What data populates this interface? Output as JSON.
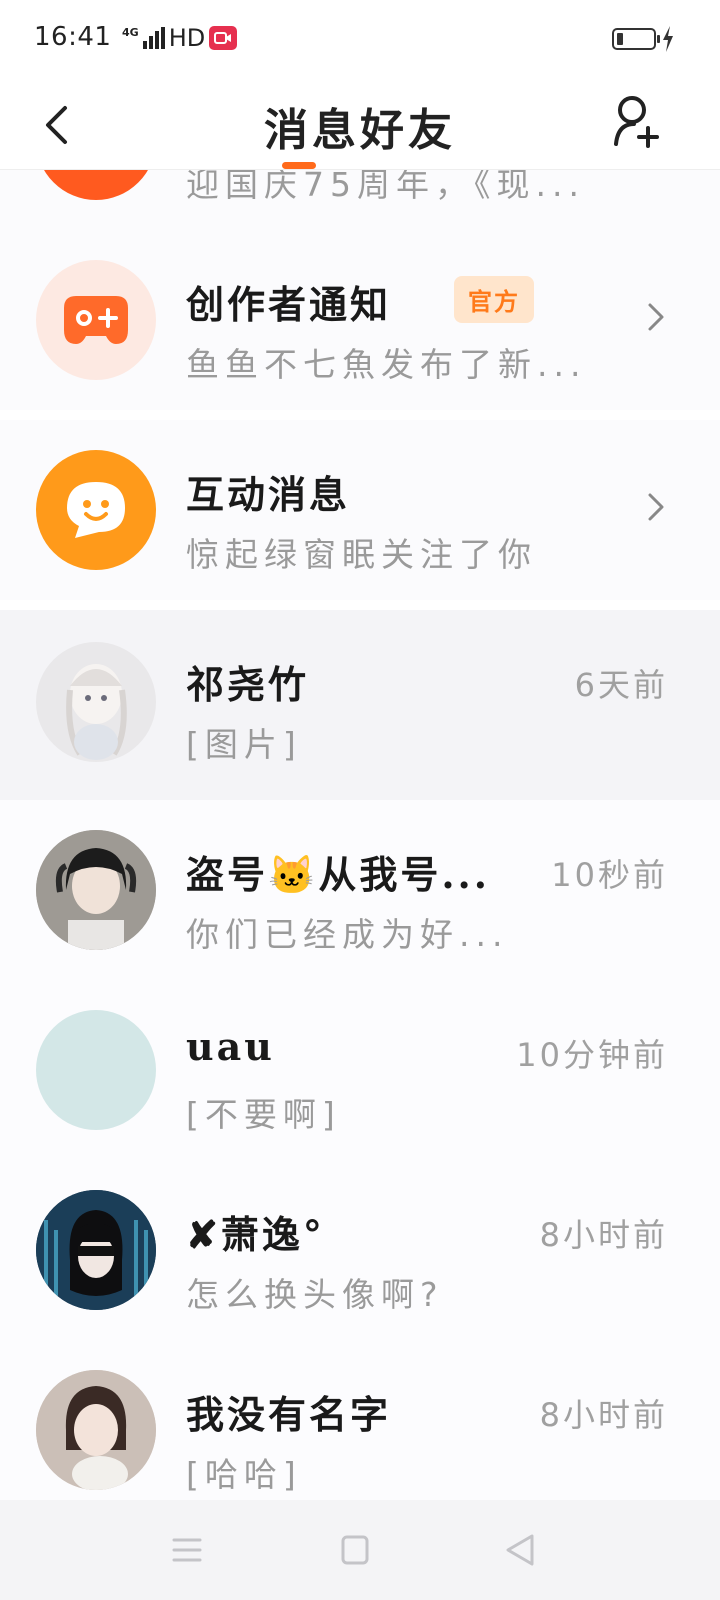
{
  "status_bar": {
    "time": "16:41",
    "network": "4G",
    "hd": "HD",
    "battery_percent": 15
  },
  "header": {
    "title": "消息好友"
  },
  "conversations": [
    {
      "kind": "system",
      "name": "",
      "preview": "迎国庆75周年，《现...",
      "avatar_color": "#ff5a1f"
    },
    {
      "kind": "system",
      "name": "创作者通知",
      "badge": "官方",
      "preview": "鱼鱼不七魚发布了新...",
      "avatar_icon": "gamepad-icon",
      "avatar_color": "#fde9e2"
    },
    {
      "kind": "system",
      "name": "互动消息",
      "preview": "惊起绿窗眠关注了你",
      "avatar_icon": "chat-bubble-icon",
      "avatar_color": "#ff9a1a"
    },
    {
      "kind": "chat",
      "name": "祁尧竹",
      "time": "6天前",
      "preview": "[图片]"
    },
    {
      "kind": "chat",
      "name": "盗号🐱从我号...",
      "time": "10秒前",
      "preview": "你们已经成为好..."
    },
    {
      "kind": "chat",
      "name": "uau",
      "time": "10分钟前",
      "preview": "[不要啊]",
      "avatar_color": "#d3e7e7"
    },
    {
      "kind": "chat",
      "name": "✘萧逸°",
      "time": "8小时前",
      "preview": "怎么换头像啊?"
    },
    {
      "kind": "chat",
      "name": "我没有名字",
      "time": "8小时前",
      "preview": "[哈哈]"
    }
  ],
  "colors": {
    "accent": "#ff6a1a",
    "badge_bg": "#ffe5cc"
  }
}
